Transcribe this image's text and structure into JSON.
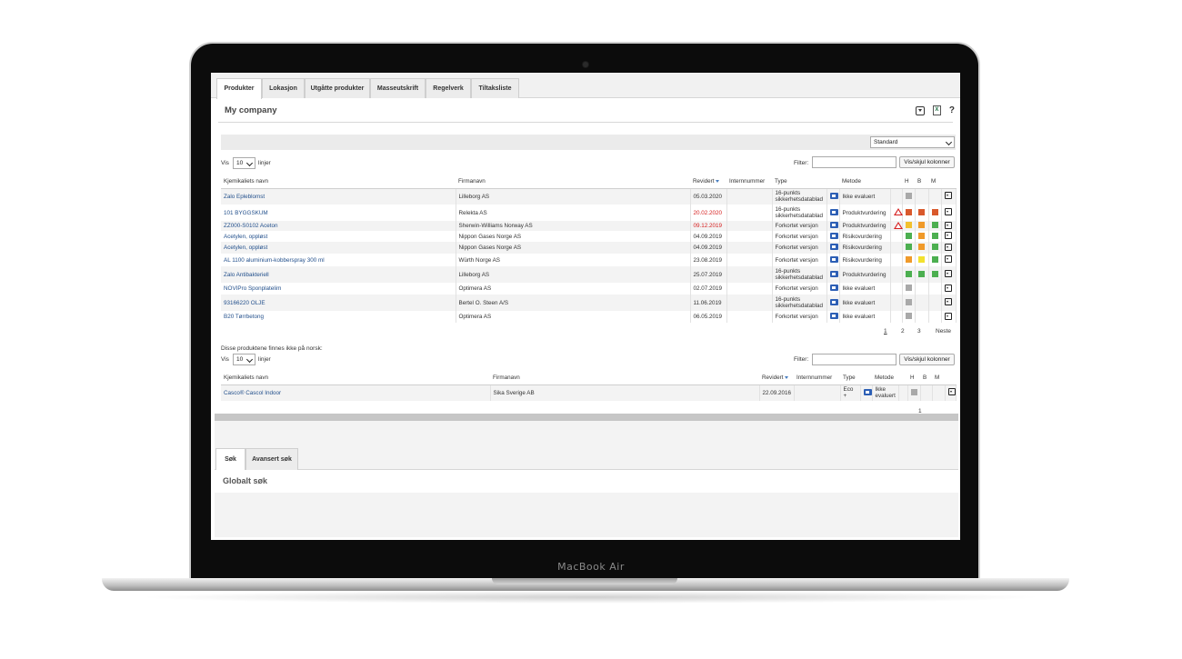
{
  "device": {
    "label": "MacBook Air"
  },
  "tabs": [
    "Produkter",
    "Lokasjon",
    "Utgåtte produkter",
    "Masseutskrift",
    "Regelverk",
    "Tiltaksliste"
  ],
  "company": {
    "title": "My company"
  },
  "toolbar": {
    "help": "?",
    "excel": "X"
  },
  "view_select": {
    "value": "Standard"
  },
  "table1": {
    "vis_label": "Vis",
    "vis_value": "10",
    "lines_label": "linjer",
    "filter_label": "Filter:",
    "columns_button": "Vis/skjul kolonner",
    "headers": {
      "name": "Kjemikaliets navn",
      "firm": "Firmanavn",
      "revised": "Revidert",
      "internal": "Internnummer",
      "type": "Type",
      "method": "Metode",
      "h": "H",
      "b": "B",
      "m": "M"
    },
    "rows": [
      {
        "name": "Zalo Epleblomst",
        "firm": "Lilleborg AS",
        "date": "05.03.2020",
        "date_color": "normal",
        "type": "16-punkts sikkerhetsdatablad",
        "method": "Ikke evaluert",
        "warn": false,
        "h": "#a9a9a9",
        "b": "",
        "m": ""
      },
      {
        "name": "101 BYGGSKUM",
        "firm": "Relekta AS",
        "date": "20.02.2020",
        "date_color": "red",
        "type": "16-punkts sikkerhetsdatablad",
        "method": "Produktvurdering",
        "warn": true,
        "h": "#d9592c",
        "b": "#d9592c",
        "m": "#d9592c"
      },
      {
        "name": "ZZ000-S0102 Aceton",
        "firm": "Sherwin-Williams Norway AS",
        "date": "09.12.2019",
        "date_color": "red",
        "type": "Forkortet versjon",
        "method": "Produktvurdering",
        "warn": true,
        "h": "#f2c12e",
        "b": "#f09a2a",
        "m": "#4caf50"
      },
      {
        "name": "Acetylen, oppløst",
        "firm": "Nippon Gases Norge AS",
        "date": "04.09.2019",
        "date_color": "normal",
        "type": "Forkortet versjon",
        "method": "Risikovurdering",
        "warn": false,
        "h": "#4caf50",
        "b": "#f09a2a",
        "m": "#4caf50"
      },
      {
        "name": "Acetylen, oppløst",
        "firm": "Nippon Gases Norge AS",
        "date": "04.09.2019",
        "date_color": "normal",
        "type": "Forkortet versjon",
        "method": "Risikovurdering",
        "warn": false,
        "h": "#4caf50",
        "b": "#f09a2a",
        "m": "#4caf50"
      },
      {
        "name": "AL 1100 aluminium-kobberspray 300 ml",
        "firm": "Würth Norge AS",
        "date": "23.08.2019",
        "date_color": "normal",
        "type": "Forkortet versjon",
        "method": "Risikovurdering",
        "warn": false,
        "h": "#f09a2a",
        "b": "#f2e12e",
        "m": "#4caf50"
      },
      {
        "name": "Zalo Antibakteriell",
        "firm": "Lilleborg AS",
        "date": "25.07.2019",
        "date_color": "normal",
        "type": "16-punkts sikkerhetsdatablad",
        "method": "Produktvurdering",
        "warn": false,
        "h": "#4caf50",
        "b": "#4caf50",
        "m": "#4caf50"
      },
      {
        "name": "NOVIPro Sponplatelim",
        "firm": "Optimera AS",
        "date": "02.07.2019",
        "date_color": "normal",
        "type": "Forkortet versjon",
        "method": "Ikke evaluert",
        "warn": false,
        "h": "#a9a9a9",
        "b": "",
        "m": ""
      },
      {
        "name": "93166220 OLJE",
        "firm": "Bertel O. Steen A/S",
        "date": "11.06.2019",
        "date_color": "normal",
        "type": "16-punkts sikkerhetsdatablad",
        "method": "Ikke evaluert",
        "warn": false,
        "h": "#a9a9a9",
        "b": "",
        "m": ""
      },
      {
        "name": "B20 Tørrbetong",
        "firm": "Optimera AS",
        "date": "06.05.2019",
        "date_color": "normal",
        "type": "Forkortet versjon",
        "method": "Ikke evaluert",
        "warn": false,
        "h": "#a9a9a9",
        "b": "",
        "m": ""
      }
    ],
    "pages": [
      "1",
      "2",
      "3"
    ],
    "next_label": "Neste"
  },
  "table2": {
    "caption": "Disse produktene finnes ikke på norsk:",
    "vis_label": "Vis",
    "vis_value": "10",
    "lines_label": "linjer",
    "filter_label": "Filter:",
    "columns_button": "Vis/skjul kolonner",
    "headers": {
      "name": "Kjemikaliets navn",
      "firm": "Firmanavn",
      "revised": "Revidert",
      "internal": "Internnummer",
      "type": "Type",
      "method": "Metode",
      "h": "H",
      "b": "B",
      "m": "M"
    },
    "rows": [
      {
        "name": "Casco® Cascol Indoor",
        "firm": "Sika Sverige AB",
        "date": "22.09.2016",
        "type": "Eco +",
        "method": "Ikke evaluert",
        "h": "#a9a9a9"
      }
    ],
    "pages": [
      "1"
    ]
  },
  "lower_tabs": [
    "Søk",
    "Avansert søk"
  ],
  "global_search": {
    "title": "Globalt søk"
  }
}
